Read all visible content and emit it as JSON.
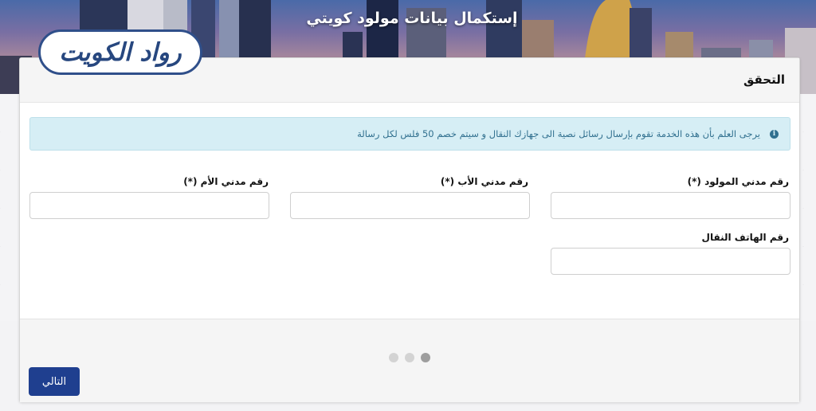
{
  "header": {
    "title": "إستكمال بيانات مولود كويتي",
    "logo_text": "رواد الكويت"
  },
  "card": {
    "title": "التحقق",
    "notice": {
      "icon": "info-icon",
      "text": "يرجى العلم بأن هذه الخدمة تقوم بإرسال رسائل نصية الى جهازك النقال و سيتم خصم 50 فلس لكل رسالة"
    },
    "fields": {
      "newborn_civil_id": {
        "label": "رقم مدني المولود (*)",
        "value": ""
      },
      "father_civil_id": {
        "label": "رقم مدني الأب (*)",
        "value": ""
      },
      "mother_civil_id": {
        "label": "رقم مدني الأم (*)",
        "value": ""
      },
      "mobile_phone": {
        "label": "رقم الهاتف النقال",
        "value": ""
      }
    }
  },
  "footer": {
    "steps_total": 3,
    "steps_current": 1,
    "next_label": "التالي"
  },
  "colors": {
    "primary": "#1f3f8f",
    "alert_bg": "#d6eef5",
    "alert_text": "#31708f",
    "logo_blue": "#27477f"
  }
}
